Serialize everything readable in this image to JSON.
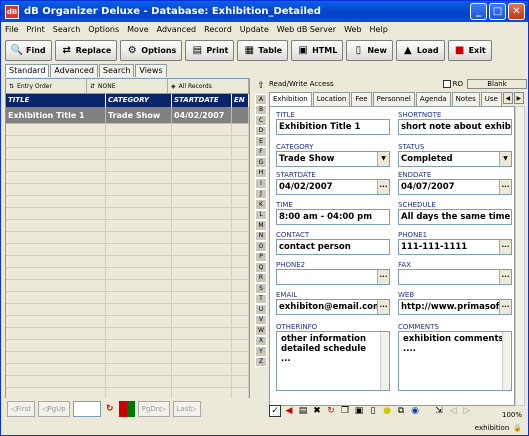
{
  "window": {
    "title": "dB Organizer Deluxe - Database: Exhibition_Detailed"
  },
  "menu": [
    "File",
    "Print",
    "Search",
    "Options",
    "Move",
    "Advanced",
    "Record",
    "Update",
    "Web dB Server",
    "Web",
    "Help"
  ],
  "toolbar": [
    "Find",
    "Replace",
    "Options",
    "Print",
    "Table",
    "HTML",
    "New",
    "Load",
    "Exit"
  ],
  "view_tabs": [
    "Standard",
    "Advanced",
    "Search",
    "Views"
  ],
  "order_bar": [
    "Entry Order",
    "NONE",
    "All Records"
  ],
  "grid": {
    "columns": [
      "TITLE",
      "CATEGORY",
      "STARTDATE",
      "EN"
    ],
    "rows": [
      [
        "Exhibition Title 1",
        "Trade Show",
        "04/02/2007",
        ""
      ]
    ]
  },
  "nav": {
    "first": "First",
    "pgup": "PgUp",
    "pgdn": "PgDn",
    "last": "Last"
  },
  "alpha": [
    "A",
    "B",
    "C",
    "D",
    "E",
    "F",
    "G",
    "H",
    "I",
    "J",
    "K",
    "L",
    "M",
    "N",
    "O",
    "P",
    "Q",
    "R",
    "S",
    "T",
    "U",
    "V",
    "W",
    "X",
    "Y",
    "Z"
  ],
  "access": {
    "mode": "Read/Write Access",
    "ro_label": "RO",
    "blank_label": "Blank"
  },
  "record_tabs": [
    "Exhibition",
    "Location",
    "Fee",
    "Personnel",
    "Agenda",
    "Notes",
    "Use"
  ],
  "form": {
    "title": {
      "label": "TITLE",
      "value": "Exhibition Title 1"
    },
    "shortnote": {
      "label": "SHORTNOTE",
      "value": "short note about exhibitio"
    },
    "category": {
      "label": "CATEGORY",
      "value": "Trade Show"
    },
    "status": {
      "label": "STATUS",
      "value": "Completed"
    },
    "startdate": {
      "label": "STARTDATE",
      "value": "04/02/2007"
    },
    "enddate": {
      "label": "ENDDATE",
      "value": "04/07/2007"
    },
    "time": {
      "label": "TIME",
      "value": "8:00 am - 04:00 pm"
    },
    "schedule": {
      "label": "SCHEDULE",
      "value": "All days the same time"
    },
    "contact": {
      "label": "CONTACT",
      "value": "contact person"
    },
    "phone1": {
      "label": "PHONE1",
      "value": "111-111-1111"
    },
    "phone2": {
      "label": "PHONE2",
      "value": ""
    },
    "fax": {
      "label": "FAX",
      "value": ""
    },
    "email": {
      "label": "EMAIL",
      "value": "exhibiton@email.com"
    },
    "web": {
      "label": "WEB",
      "value": "http://www.primasoft.c"
    },
    "otherinfo": {
      "label": "OTHERINFO",
      "value": "other information\ndetailed schedule\n..."
    },
    "comments": {
      "label": "COMMENTS",
      "value": "exhibition comments\n...."
    }
  },
  "status": {
    "zoom": "100%",
    "db": "exhibition"
  }
}
